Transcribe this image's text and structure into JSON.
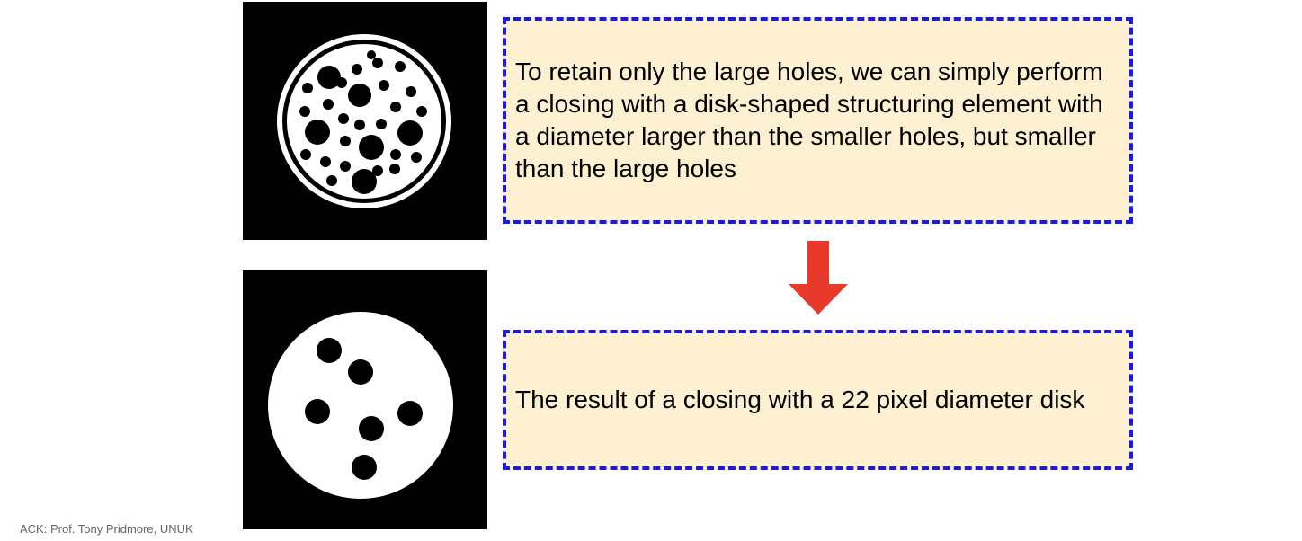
{
  "top_callout": {
    "text": "To retain only the large holes, we can simply perform a closing with a disk-shaped structuring element with a diameter larger than the smaller holes, but smaller than the large holes"
  },
  "bottom_callout": {
    "text": "The result of a closing with a 22 pixel diameter disk"
  },
  "acknowledgement": "ACK: Prof. Tony Pridmore, UNUK",
  "colors": {
    "callout_fill": "#fdf1d1",
    "callout_border": "#1a1ae6",
    "arrow": "#e8392a",
    "image_background": "#000000",
    "image_foreground": "#ffffff"
  },
  "icons": {
    "arrow": "arrow-down-icon"
  }
}
